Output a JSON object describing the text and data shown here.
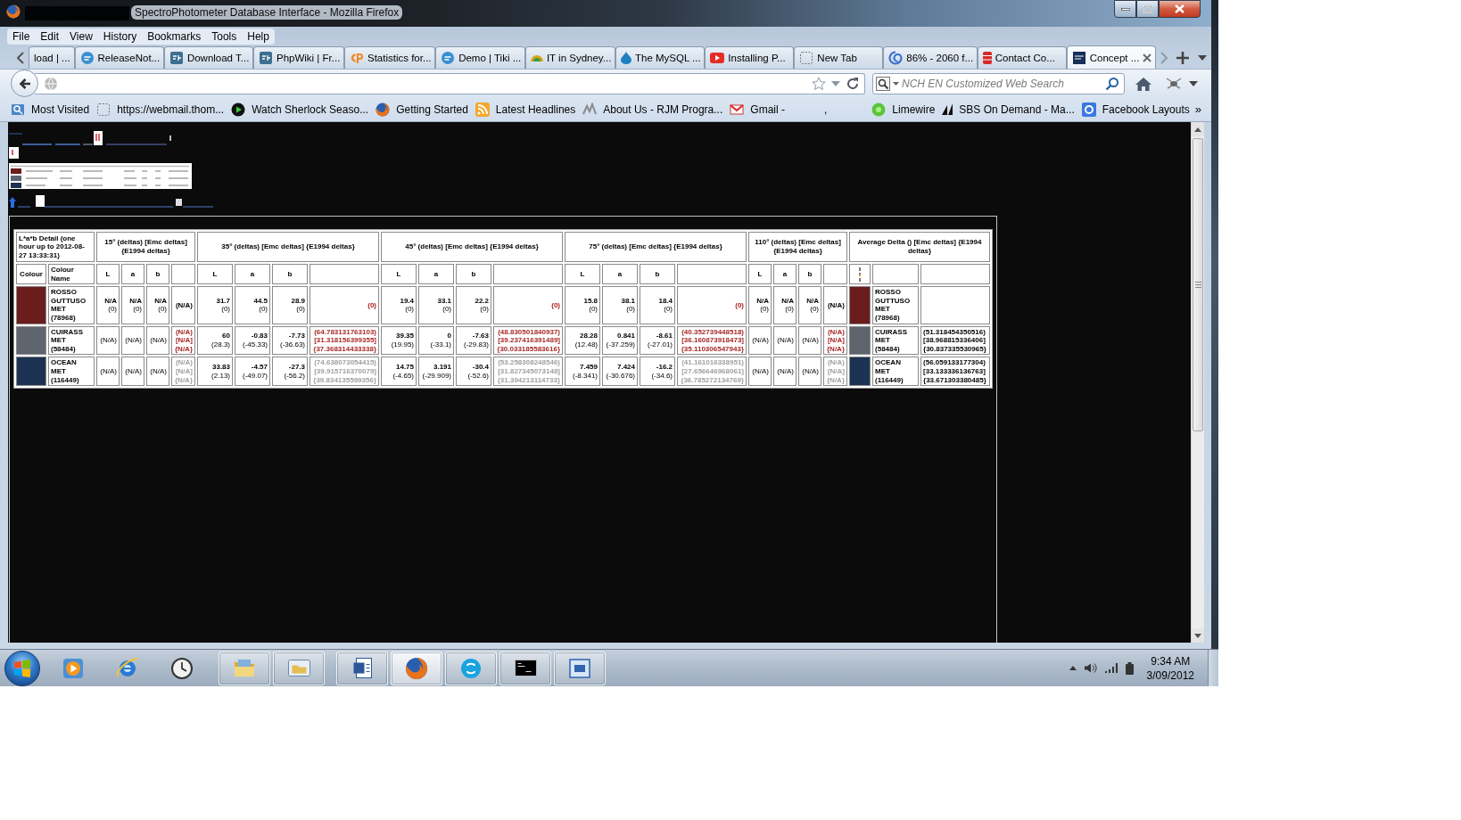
{
  "window": {
    "title": "SpectroPhotometer Database Interface - Mozilla Firefox"
  },
  "menu": [
    "File",
    "Edit",
    "View",
    "History",
    "Bookmarks",
    "Tools",
    "Help"
  ],
  "tabs": [
    {
      "label": "load | ...",
      "selected": false
    },
    {
      "label": "ReleaseNot...",
      "selected": false
    },
    {
      "label": "Download T...",
      "selected": false
    },
    {
      "label": "PhpWiki | Fr...",
      "selected": false
    },
    {
      "label": "Statistics for...",
      "selected": false
    },
    {
      "label": "Demo | Tiki ...",
      "selected": false
    },
    {
      "label": "IT in Sydney...",
      "selected": false
    },
    {
      "label": "The MySQL ...",
      "selected": false
    },
    {
      "label": "Installing P...",
      "selected": false
    },
    {
      "label": "New Tab",
      "selected": false
    },
    {
      "label": "86% - 2060 f...",
      "selected": false
    },
    {
      "label": "Contact Co...",
      "selected": false
    },
    {
      "label": "Concept ...",
      "selected": true
    }
  ],
  "search": {
    "placeholder": "NCH EN Customized Web Search"
  },
  "bookmarks": [
    "Most Visited",
    "https://webmail.thom...",
    "Watch Sherlock Seaso...",
    "Getting Started",
    "Latest Headlines",
    "About Us - RJM Progra...",
    "Gmail -",
    ",",
    "Limewire",
    "SBS On Demand - Ma...",
    "Facebook Layouts"
  ],
  "bookmarks_overflow": "»",
  "table": {
    "caption": "L*a*b Detail (one hour up to 2012-08-27 13:33:31)",
    "colour_header": "Colour",
    "name_header": "Colour Name",
    "angles": [
      {
        "title": "15° (deltas) [Emc deltas] {E1994 deltas}",
        "columns": [
          "L",
          "a",
          "b"
        ]
      },
      {
        "title": "35° (deltas) [Emc deltas] {E1994 deltas}",
        "columns": [
          "L",
          "a",
          "b"
        ]
      },
      {
        "title": "45° (deltas) [Emc deltas] {E1994 deltas}",
        "columns": [
          "L",
          "a",
          "b"
        ]
      },
      {
        "title": "75° (deltas) [Emc deltas] {E1994 deltas}",
        "columns": [
          "L",
          "a",
          "b"
        ]
      },
      {
        "title": "110° (deltas) [Emc deltas] {E1994 deltas}",
        "columns": [
          "L",
          "a",
          "b"
        ]
      }
    ],
    "average_title": "Average Delta () [Emc deltas] {E1994 deltas}",
    "rows": [
      {
        "name": "ROSSO GUTTUSO MET (78968)",
        "color": "#6b1c1c",
        "angles": [
          {
            "cells": [
              {
                "value": "N/A",
                "delta": "(0)"
              },
              {
                "value": "N/A",
                "delta": "(0)"
              },
              {
                "value": "N/A",
                "delta": "(0)"
              }
            ],
            "delta_e": {
              "lines": [
                "(N/A)"
              ],
              "color": "#000000"
            }
          },
          {
            "cells": [
              {
                "value": "31.7",
                "delta": "(0)"
              },
              {
                "value": "44.5",
                "delta": "(0)"
              },
              {
                "value": "28.9",
                "delta": "(0)"
              }
            ],
            "delta_e": {
              "lines": [
                "(0)"
              ],
              "color": "#b01818"
            }
          },
          {
            "cells": [
              {
                "value": "19.4",
                "delta": "(0)"
              },
              {
                "value": "33.1",
                "delta": "(0)"
              },
              {
                "value": "22.2",
                "delta": "(0)"
              }
            ],
            "delta_e": {
              "lines": [
                "(0)"
              ],
              "color": "#b01818"
            }
          },
          {
            "cells": [
              {
                "value": "15.8",
                "delta": "(0)"
              },
              {
                "value": "38.1",
                "delta": "(0)"
              },
              {
                "value": "18.4",
                "delta": "(0)"
              }
            ],
            "delta_e": {
              "lines": [
                "(0)"
              ],
              "color": "#b01818"
            }
          },
          {
            "cells": [
              {
                "value": "N/A",
                "delta": "(0)"
              },
              {
                "value": "N/A",
                "delta": "(0)"
              },
              {
                "value": "N/A",
                "delta": "(0)"
              }
            ],
            "delta_e": {
              "lines": [
                "(N/A)"
              ],
              "color": "#000000"
            }
          }
        ],
        "average": {
          "name": "ROSSO GUTTUSO MET (78968)"
        }
      },
      {
        "name": "CUIRASS MET (58484)",
        "color": "#5f656e",
        "angles": [
          {
            "cells": [
              {
                "delta": "(N/A)"
              },
              {
                "delta": "(N/A)"
              },
              {
                "delta": "(N/A)"
              }
            ],
            "delta_e": {
              "lines": [
                "(N/A)",
                "[N/A]",
                "{N/A}"
              ],
              "color": "#a82828"
            }
          },
          {
            "cells": [
              {
                "value": "60",
                "delta": "(28.3)"
              },
              {
                "value": "-0.83",
                "delta": "(-45.33)"
              },
              {
                "value": "-7.73",
                "delta": "(-36.63)"
              }
            ],
            "delta_e": {
              "lines": [
                "(64.783131763103)",
                "[31.318156399355]",
                "{37.368314433338}"
              ],
              "color": "#a82828"
            }
          },
          {
            "cells": [
              {
                "value": "39.35",
                "delta": "(19.95)"
              },
              {
                "value": "0",
                "delta": "(-33.1)"
              },
              {
                "value": "-7.63",
                "delta": "(-29.83)"
              }
            ],
            "delta_e": {
              "lines": [
                "(48.830501840937)",
                "[39.237416391489]",
                "{30.033185583616}"
              ],
              "color": "#a82828"
            }
          },
          {
            "cells": [
              {
                "value": "28.28",
                "delta": "(12.48)"
              },
              {
                "value": "0.841",
                "delta": "(-37.259)"
              },
              {
                "value": "-8.61",
                "delta": "(-27.01)"
              }
            ],
            "delta_e": {
              "lines": [
                "(40.352739448518)",
                "[36.160873918473]",
                "{35.110306547943}"
              ],
              "color": "#a82828"
            }
          },
          {
            "cells": [
              {
                "delta": "(N/A)"
              },
              {
                "delta": "(N/A)"
              },
              {
                "delta": "(N/A)"
              }
            ],
            "delta_e": {
              "lines": [
                "(N/A)",
                "[N/A]",
                "{N/A}"
              ],
              "color": "#a82828"
            }
          }
        ],
        "average": {
          "name": "CUIRASS MET (58484)",
          "lines": [
            "(51.318454350516)",
            "[38.968815336406]",
            "{30.837335530965}"
          ]
        }
      },
      {
        "name": "OCEAN MET (116449)",
        "color": "#1b3252",
        "angles": [
          {
            "cells": [
              {
                "delta": "(N/A)"
              },
              {
                "delta": "(N/A)"
              },
              {
                "delta": "(N/A)"
              }
            ],
            "delta_e": {
              "lines": [
                "(N/A)",
                "[N/A]",
                "{N/A}"
              ],
              "color": "#a0a0a0"
            }
          },
          {
            "cells": [
              {
                "value": "33.83",
                "delta": "(2.13)"
              },
              {
                "value": "-4.57",
                "delta": "(-49.07)"
              },
              {
                "value": "-27.3",
                "delta": "(-56.2)"
              }
            ],
            "delta_e": {
              "lines": [
                "(74.638073054415)",
                "[39.915716370079]",
                "{39.834135599356}"
              ],
              "color": "#a0a0a0"
            }
          },
          {
            "cells": [
              {
                "value": "14.75",
                "delta": "(-4.65)"
              },
              {
                "value": "3.191",
                "delta": "(-29.909)"
              },
              {
                "value": "-30.4",
                "delta": "(-52.6)"
              }
            ],
            "delta_e": {
              "lines": [
                "(53.258308248546)",
                "[31.827345073148]",
                "{31.394213114733}"
              ],
              "color": "#a0a0a0"
            }
          },
          {
            "cells": [
              {
                "value": "7.459",
                "delta": "(-8.341)"
              },
              {
                "value": "7.424",
                "delta": "(-30.676)"
              },
              {
                "value": "-16.2",
                "delta": "(-34.6)"
              }
            ],
            "delta_e": {
              "lines": [
                "(41.161016338951)",
                "[27.656646968061]",
                "{36.785272134769}"
              ],
              "color": "#a0a0a0"
            }
          },
          {
            "cells": [
              {
                "delta": "(N/A)"
              },
              {
                "delta": "(N/A)"
              },
              {
                "delta": "(N/A)"
              }
            ],
            "delta_e": {
              "lines": [
                "(N/A)",
                "[N/A]",
                "{N/A}"
              ],
              "color": "#a0a0a0"
            }
          }
        ],
        "average": {
          "name": "OCEAN MET (116449)",
          "lines": [
            "(56.059133177304)",
            "[33.133336136763]",
            "{33.671303380485}"
          ]
        }
      }
    ]
  },
  "taskbar": {
    "items": [
      {
        "running": false,
        "selected": false
      },
      {
        "running": false,
        "selected": false
      },
      {
        "running": false,
        "selected": false
      },
      {
        "running": true,
        "selected": false
      },
      {
        "running": true,
        "selected": false
      },
      {
        "running": true,
        "selected": false
      },
      {
        "running": true,
        "selected": true
      },
      {
        "running": true,
        "selected": false
      },
      {
        "running": true,
        "selected": false
      },
      {
        "running": true,
        "selected": false
      }
    ],
    "time": "9:34 AM",
    "date": "3/09/2012"
  }
}
